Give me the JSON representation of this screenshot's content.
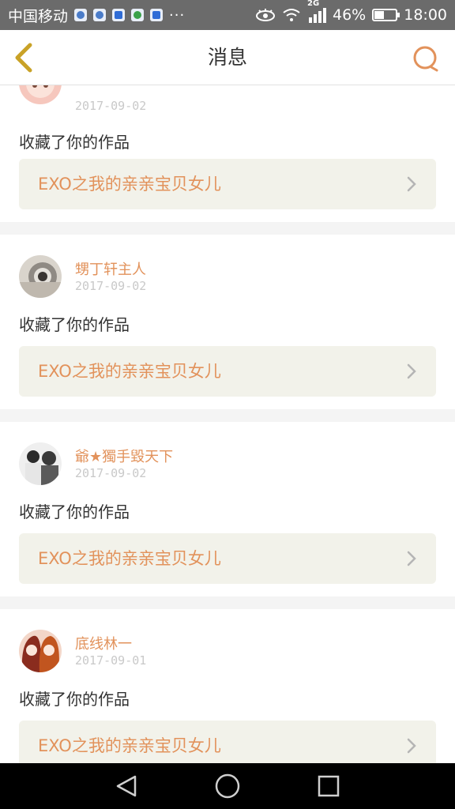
{
  "status_bar": {
    "carrier": "中国移动",
    "more": "···",
    "network": "2G",
    "battery_percent": "46%",
    "battery_level": 0.46,
    "time": "18:00",
    "icons": [
      "qq-icon",
      "browser-icon",
      "mail-icon",
      "wechat-icon",
      "mail-icon",
      "eye-icon",
      "wifi-icon",
      "signal-icon",
      "battery-icon"
    ]
  },
  "header": {
    "title": "消息",
    "back_icon": "chevron-left-icon",
    "search_icon": "search-icon",
    "accent": "#e2925b",
    "back_color": "#c9a227"
  },
  "messages": [
    {
      "user": "",
      "date": "2017-09-02",
      "action": "收藏了你的作品",
      "work_title": "EXO之我的亲亲宝贝女儿"
    },
    {
      "user": "甥丁轩主人",
      "date": "2017-09-02",
      "action": "收藏了你的作品",
      "work_title": "EXO之我的亲亲宝贝女儿"
    },
    {
      "user": "爺★獨手毀天下",
      "date": "2017-09-02",
      "action": "收藏了你的作品",
      "work_title": "EXO之我的亲亲宝贝女儿"
    },
    {
      "user": "底线林一",
      "date": "2017-09-01",
      "action": "收藏了你的作品",
      "work_title": "EXO之我的亲亲宝贝女儿"
    }
  ],
  "nav_bar": {
    "icons": [
      "back-triangle-icon",
      "home-circle-icon",
      "recents-square-icon"
    ]
  }
}
